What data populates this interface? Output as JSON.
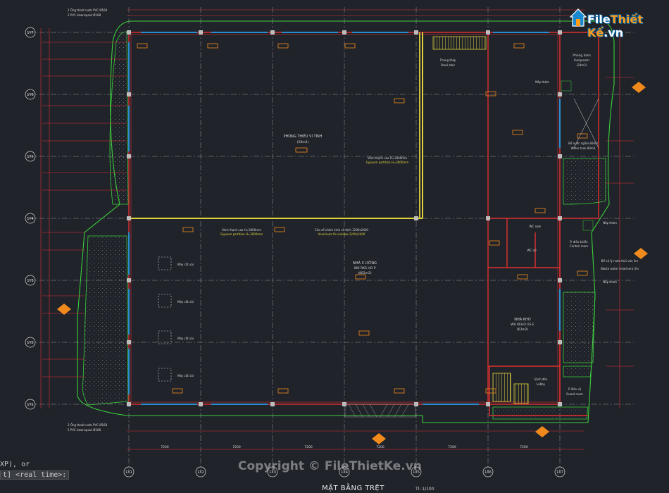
{
  "drawing": {
    "title": "MẶT BẰNG TRỆT",
    "scale": "Tl: 1/100",
    "copyright": "Copyright © FileThietKe.vn",
    "logo": {
      "brand": "File",
      "brand_accent": "Thiết Kế",
      "domain": ".vn",
      "icon": "house-logo-icon"
    },
    "command_line": [
      "XP), or",
      "t] <real time>:"
    ]
  },
  "grid": {
    "rows": [
      "1Y7",
      "1Y6",
      "1Y5",
      "1Y4",
      "1Y3",
      "1Y2",
      "1Y1"
    ],
    "cols": [
      "1X1",
      "1X2",
      "1X3",
      "1X4",
      "1X5",
      "1X6",
      "1X7"
    ]
  },
  "rooms": {
    "room_a_name": "PHÒNG THIÊU VI TÍNH",
    "room_a_area": "(56m2)",
    "workshop_name": "NHÀ X ƯỞNG",
    "workshop_sub": "WO RKS HO P",
    "workshop_area": "(802m2)",
    "warehouse_name": "NHÀ KHO",
    "warehouse_sub": "WA REHO US E",
    "warehouse_area": "(63m2)",
    "pump_name": "Phòng bơm",
    "pump_sub": "Pumproom",
    "pump_area": "(24m2)",
    "steel_stair": "Thang thép",
    "steel_stair_en": "Steel stair",
    "tank": "Bể nước ngầm 80m3",
    "tank_en": "Water tank 80m3",
    "wc": "WC nam",
    "wc_nu": "WC nữ",
    "pdl": "P. điều khiển",
    "pdl_en": "Control room",
    "septic": "Bể xử lý nước thải văn 3m",
    "septic_en": "Waste water treatment 3m",
    "hall": "Sảnh đón",
    "hall_en": "Lobby",
    "guard": "P. Bảo vệ",
    "guard_en": "Guard room",
    "sewing": [
      "Máy cắt vải",
      "Máy cắt vải",
      "Máy cắt vải",
      "Máy cắt vải"
    ],
    "partition1": "Vách thạch cao H=3000mm",
    "partition1_en": "Gypsum partition H=3000mm",
    "partition2": "Vách thạch cao H=3000mm",
    "partition2_en": "Gypsum partition H=3000mm",
    "window": "Cửa sổ nhôm kính cố định 1200x2400",
    "window_en": "Aluminum fix window 1200x2400",
    "drain_top": "2 Ống thoát nước PVC Ø168",
    "drain_top2": "2 PVC downspout Ø168",
    "drain_bot": "2 Ống thoát nước PVC Ø168",
    "drain_bot2": "2 PVC downspout Ø168",
    "door_top": "Nắp thăm",
    "door_mid": "Nắp thăm",
    "door_low": "Nắp thăm"
  },
  "dims_bottom": [
    "7200",
    "7200",
    "7200",
    "7200",
    "7200",
    "7200"
  ],
  "colors": {
    "background": "#20232a",
    "wall": "#e03030",
    "landscape": "#3bd13b",
    "grid_line": "#9a9a9a",
    "tag": "#f08a1c",
    "partition": "#e0d23a",
    "window": "#2a8fd0",
    "text": "#d8d8d8"
  }
}
